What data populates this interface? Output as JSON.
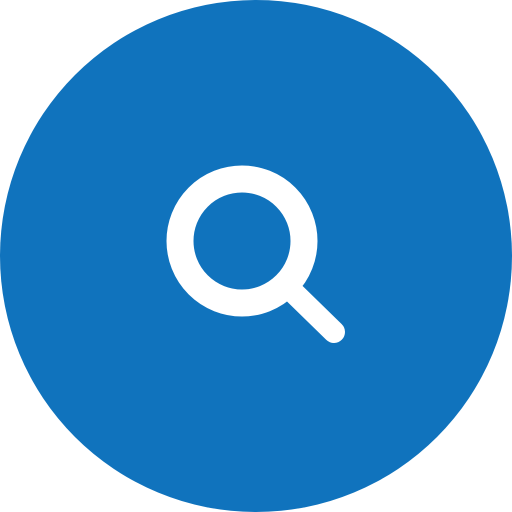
{
  "search_button": {
    "icon": "search-icon",
    "background_color": "#1073bd",
    "icon_color": "#ffffff"
  }
}
